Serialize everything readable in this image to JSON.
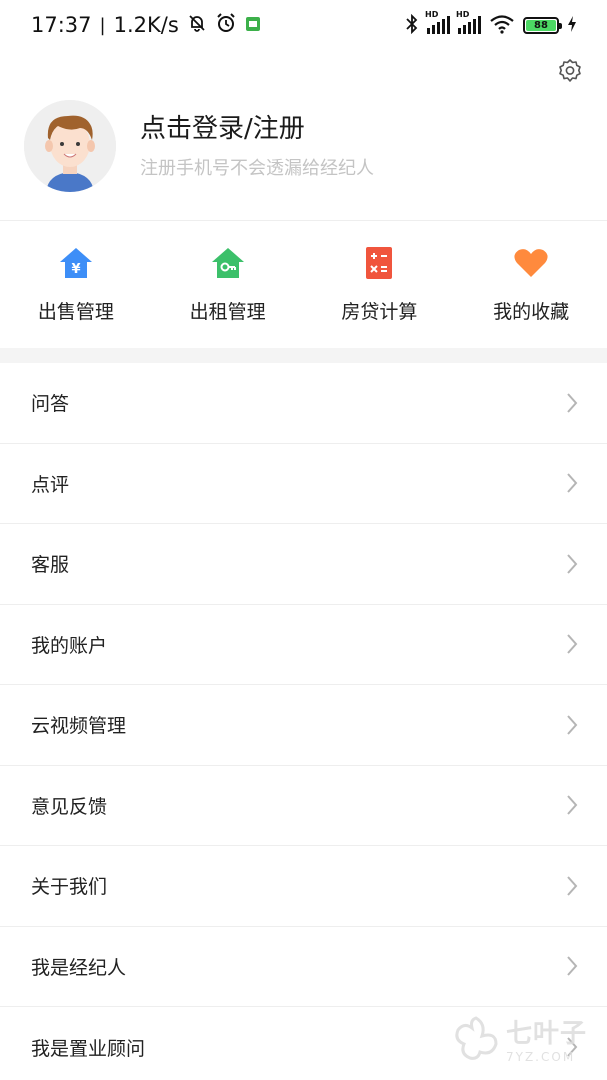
{
  "status_bar": {
    "time": "17:37",
    "net_speed": "1.2K/s",
    "sim1": "HD",
    "sim2": "HD",
    "battery": "88"
  },
  "profile": {
    "login_title": "点击登录/注册",
    "login_subtitle": "注册手机号不会透漏给经纪人"
  },
  "quick_actions": [
    {
      "label": "出售管理",
      "icon": "sale-house-icon",
      "color": "#3d8ef7"
    },
    {
      "label": "出租管理",
      "icon": "rent-house-key-icon",
      "color": "#3cc06a"
    },
    {
      "label": "房贷计算",
      "icon": "calculator-icon",
      "color": "#f0553d"
    },
    {
      "label": "我的收藏",
      "icon": "heart-icon",
      "color": "#ff8a3d"
    }
  ],
  "menu": [
    {
      "label": "问答"
    },
    {
      "label": "点评"
    },
    {
      "label": "客服"
    },
    {
      "label": "我的账户"
    },
    {
      "label": "云视频管理"
    },
    {
      "label": "意见反馈"
    },
    {
      "label": "关于我们"
    },
    {
      "label": "我是经纪人"
    },
    {
      "label": "我是置业顾问"
    }
  ],
  "watermark": {
    "title": "七叶子",
    "url": "7YZ.COM"
  }
}
